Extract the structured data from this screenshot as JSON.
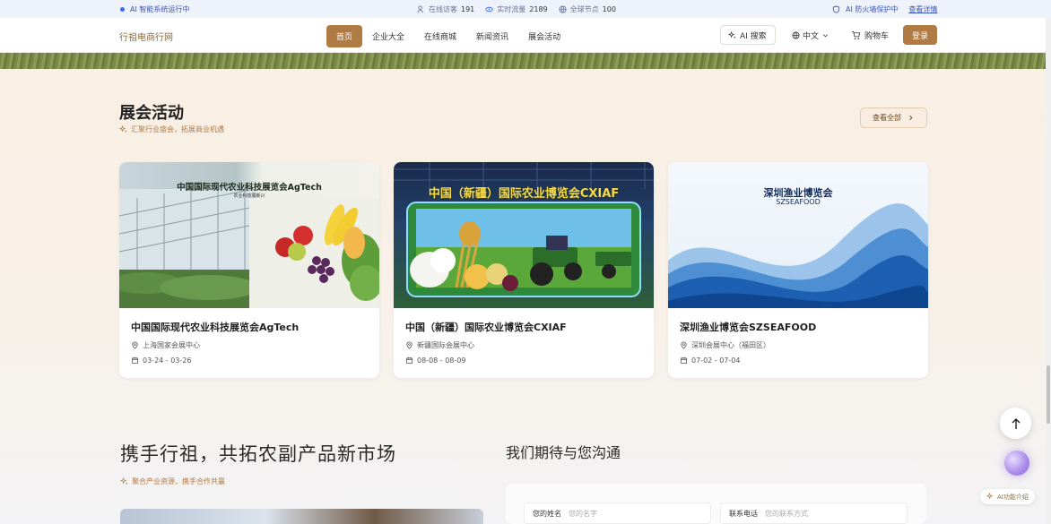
{
  "status_bar": {
    "system": "AI 智能系统运行中",
    "online_label": "在线访客",
    "online_value": "191",
    "traffic_label": "实时流量",
    "traffic_value": "2189",
    "nodes_label": "全球节点",
    "nodes_value": "100",
    "firewall": "AI 防火墙保护中",
    "details_link": "查看详情"
  },
  "nav": {
    "logo": "行祖电商行网",
    "menu": [
      "首页",
      "企业大全",
      "在线商城",
      "新闻资讯",
      "展会活动"
    ],
    "ai_search": "AI 搜索",
    "language": "中文",
    "cart": "购物车",
    "login": "登录"
  },
  "events": {
    "title": "展会活动",
    "subtitle": "汇聚行业盛会，拓展商业机遇",
    "view_all": "查看全部",
    "cards": [
      {
        "img_title": "中国国际现代农业科技展览会AgTech",
        "img_sub": "农业科技展新兴",
        "title": "中国国际现代农业科技展览会AgTech",
        "location": "上海国家会展中心",
        "date": "03-24 - 03-26"
      },
      {
        "img_title": "中国（新疆）国际农业博览会CXIAF",
        "title": "中国（新疆）国际农业博览会CXIAF",
        "location": "新疆国际会展中心",
        "date": "08-08 - 08-09"
      },
      {
        "img_title": "深圳渔业博览会",
        "img_sub": "SZSEAFOOD",
        "title": "深圳渔业博览会SZSEAFOOD",
        "location": "深圳会展中心（福田区）",
        "date": "07-02 - 07-04"
      }
    ]
  },
  "partner": {
    "title": "携手行祖，共拓农副产品新市场",
    "subtitle": "聚合产业资源，携手合作共赢"
  },
  "contact": {
    "title": "我们期待与您沟通",
    "name_label": "您的姓名",
    "name_placeholder": "您的名字",
    "phone_label": "联系电话",
    "phone_placeholder": "您的联系方式"
  },
  "floating": {
    "ai_intro": "AI功能介绍"
  }
}
